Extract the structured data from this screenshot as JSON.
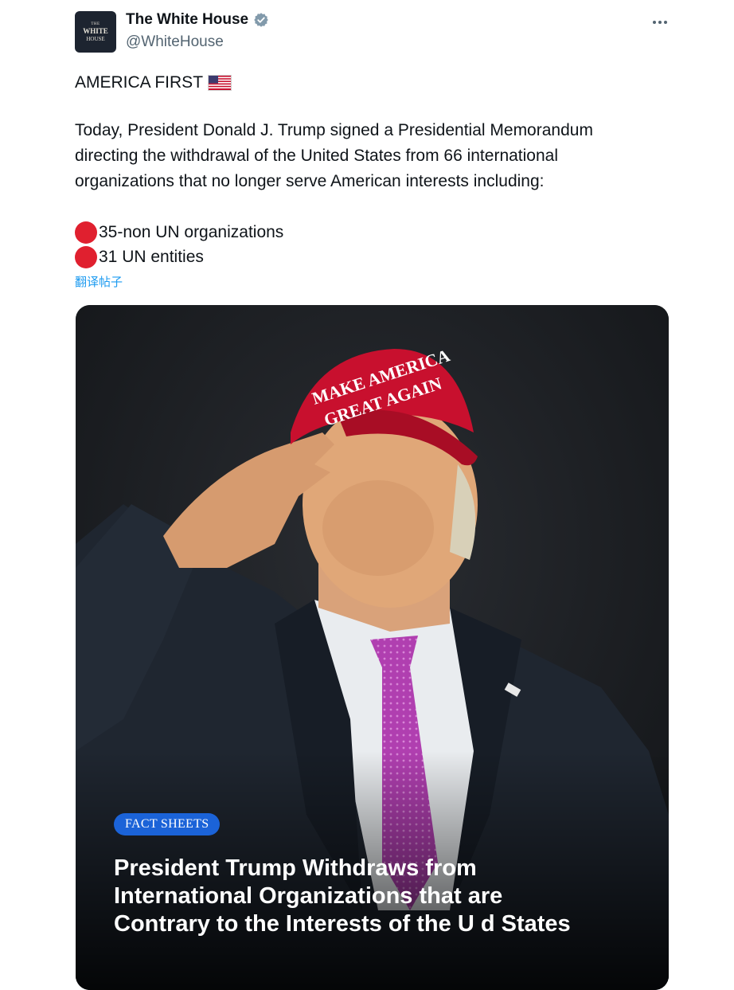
{
  "author": {
    "avatar_text": [
      "THE",
      "WHITE",
      "HOUSE"
    ],
    "display_name": "The White House",
    "handle": "@WhiteHouse",
    "verified_icon": "verified-badge-icon"
  },
  "more_icon": "more-horizontal-icon",
  "post": {
    "headline": "AMERICA FIRST",
    "headline_emoji": "us-flag-icon",
    "paragraph_lines": [
      "Today, President Donald J. Trump signed a Presidential Memorandum",
      "directing the withdrawal of the United States from 66 international",
      "organizations that no longer serve American interests including:"
    ],
    "bullets": [
      {
        "icon": "red-circle-icon",
        "text": "35-non UN organizations"
      },
      {
        "icon": "red-circle-icon",
        "text": "31 UN entities"
      }
    ],
    "translate_label": "翻译帖子"
  },
  "media": {
    "hat_text_lines": [
      "MAKE AMERICA",
      "GREAT AGAIN"
    ],
    "badge": "FACT SHEETS",
    "title_lines": [
      "President Trump Withdraws from",
      "International Organizations that are",
      "Contrary to the Interests of the U   d States"
    ]
  },
  "colors": {
    "accent": "#1d9bf0",
    "badge": "#1b63d8",
    "bullet_red": "#e0202f",
    "hat_red": "#c8102e",
    "tie": "#b03fb0"
  }
}
